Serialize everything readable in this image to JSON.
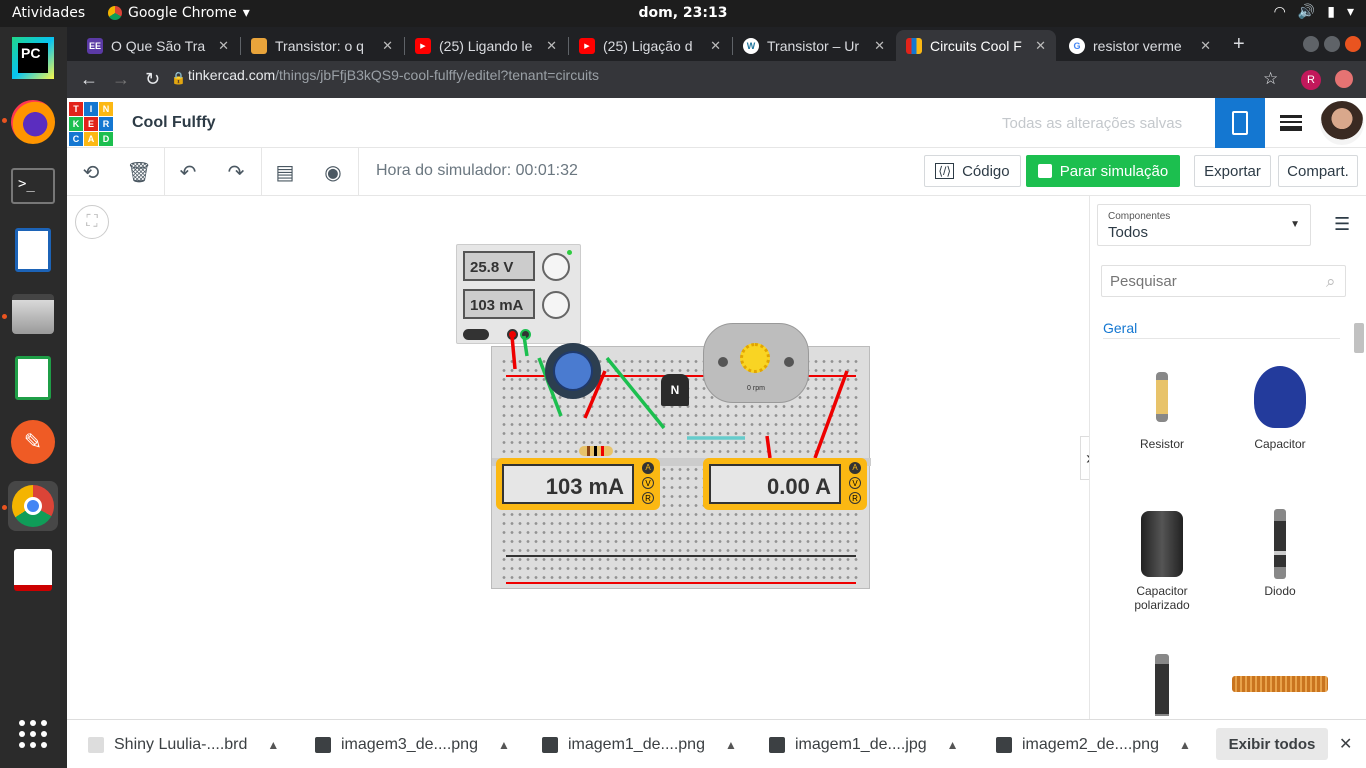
{
  "system": {
    "activities": "Atividades",
    "app_name": "Google Chrome",
    "clock": "dom, 23:13"
  },
  "tabs": [
    {
      "title": "O Que São Tra",
      "favicon": "EE"
    },
    {
      "title": "Transistor: o q",
      "favicon": ""
    },
    {
      "title": "(25) Ligando le",
      "favicon": "▶"
    },
    {
      "title": "(25) Ligação d",
      "favicon": "▶"
    },
    {
      "title": "Transistor – Ur",
      "favicon": "W"
    },
    {
      "title": "Circuits Cool F",
      "favicon": ""
    },
    {
      "title": "resistor verme",
      "favicon": "G"
    }
  ],
  "address": {
    "host": "tinkercad.com",
    "path": "/things/jbFfjB3kQS9-cool-fulffy/editel?tenant=circuits"
  },
  "tinkercad": {
    "logo_letters": [
      "T",
      "I",
      "N",
      "K",
      "E",
      "R",
      "C",
      "A",
      "D"
    ],
    "project_name": "Cool Fulffy",
    "save_status": "Todas as alterações salvas"
  },
  "editor": {
    "sim_time": "Hora do simulador: 00:01:32",
    "code_label": "Código",
    "stop_label": "Parar simulação",
    "export_label": "Exportar",
    "share_label": "Compart."
  },
  "circuit": {
    "power_voltage": "25.8 V",
    "power_current": "103 mA",
    "meter1": "103 mA",
    "meter2": "0.00 A",
    "motor_rpm": "0 rpm",
    "transistor_label": "N",
    "meter_modes": [
      "A",
      "V",
      "R"
    ]
  },
  "panel": {
    "select_caption": "Componentes",
    "select_value": "Todos",
    "search_placeholder": "Pesquisar",
    "category": "Geral",
    "components": [
      "Resistor",
      "Capacitor",
      "Capacitor polarizado",
      "Diodo"
    ]
  },
  "downloads": {
    "items": [
      "Shiny Luulia-....brd",
      "imagem3_de....png",
      "imagem1_de....png",
      "imagem1_de....jpg",
      "imagem2_de....png"
    ],
    "show_all": "Exibir todos"
  }
}
